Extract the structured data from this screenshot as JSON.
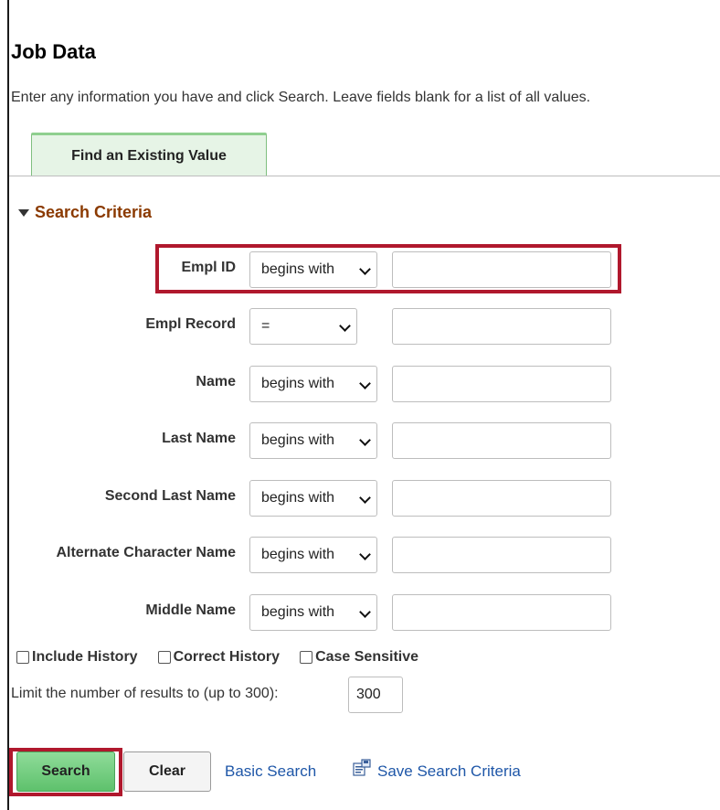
{
  "page": {
    "title": "Job Data",
    "instructions": "Enter any information you have and click Search. Leave fields blank for a list of all values."
  },
  "tab": {
    "label": "Find an Existing Value"
  },
  "search_criteria": {
    "header": "Search Criteria",
    "fields": [
      {
        "label": "Empl ID",
        "operator": "begins with",
        "value": ""
      },
      {
        "label": "Empl Record",
        "operator": "=",
        "value": ""
      },
      {
        "label": "Name",
        "operator": "begins with",
        "value": ""
      },
      {
        "label": "Last Name",
        "operator": "begins with",
        "value": ""
      },
      {
        "label": "Second Last Name",
        "operator": "begins with",
        "value": ""
      },
      {
        "label": "Alternate Character Name",
        "operator": "begins with",
        "value": ""
      },
      {
        "label": "Middle Name",
        "operator": "begins with",
        "value": ""
      }
    ]
  },
  "options": {
    "include_history": "Include History",
    "correct_history": "Correct History",
    "case_sensitive": "Case Sensitive"
  },
  "limit": {
    "label": "Limit the number of results to (up to 300):",
    "value": "300"
  },
  "actions": {
    "search": "Search",
    "clear": "Clear",
    "basic_search": "Basic Search",
    "save_search_criteria": "Save Search Criteria"
  },
  "colors": {
    "highlight": "#b0182d",
    "section_header": "#8b3a00",
    "link": "#1f57a8",
    "search_button": "#6fcf7c"
  }
}
